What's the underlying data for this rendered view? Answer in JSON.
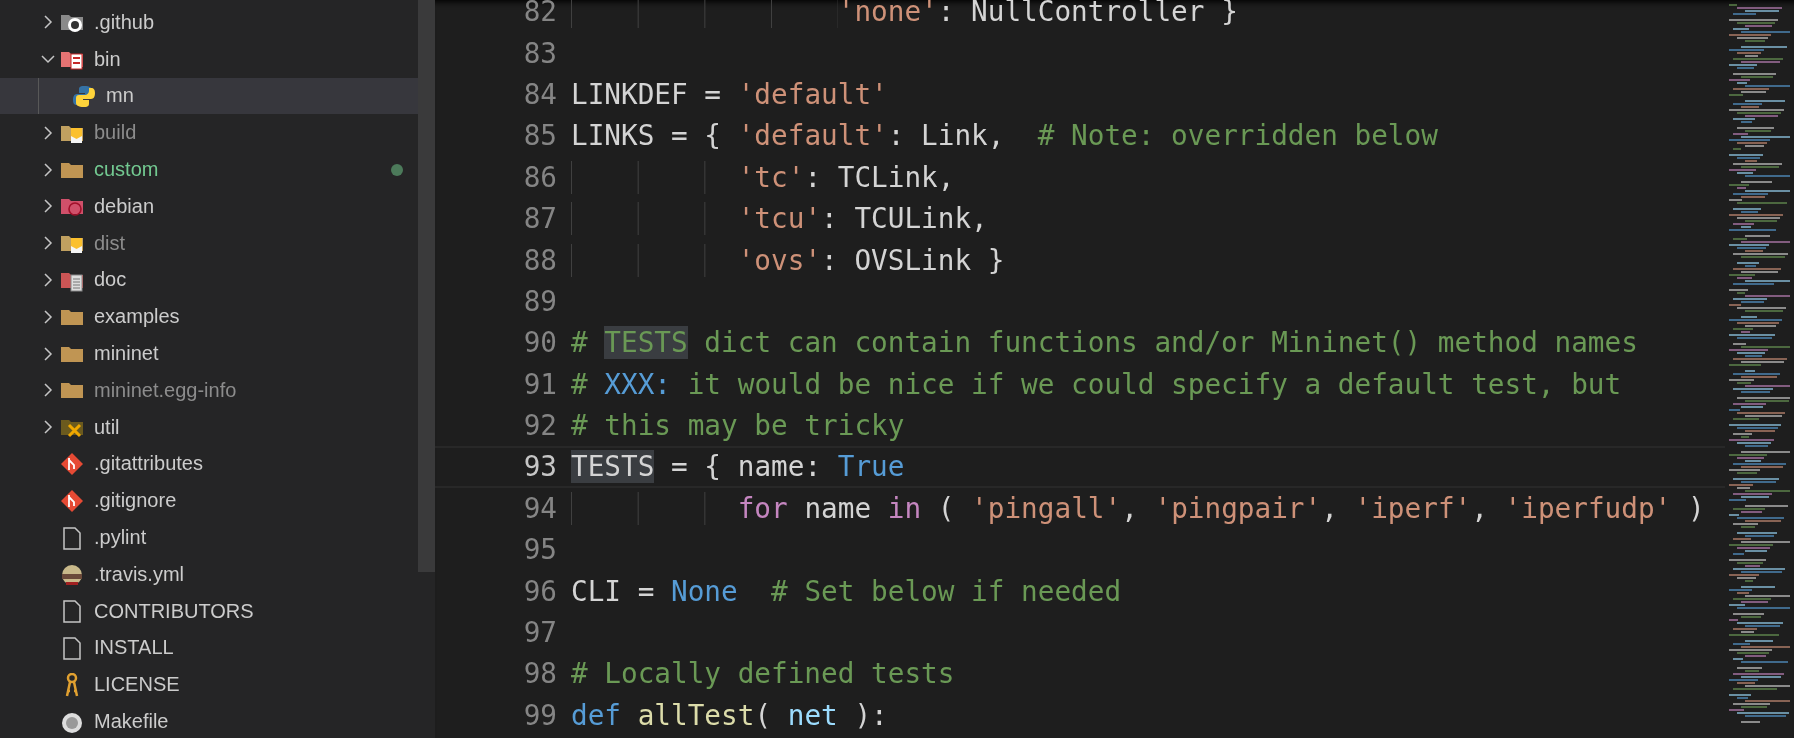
{
  "explorer": {
    "items": [
      {
        "name": ".github",
        "kind": "github-folder",
        "expanded": false,
        "ignored": false,
        "modified": false,
        "selected": false
      },
      {
        "name": "bin",
        "kind": "binary-folder",
        "expanded": true,
        "ignored": false,
        "modified": false,
        "selected": false,
        "children": [
          {
            "name": "mn",
            "kind": "python",
            "ignored": false,
            "modified": false,
            "selected": true
          }
        ]
      },
      {
        "name": "build",
        "kind": "package-folder",
        "expanded": false,
        "ignored": true,
        "modified": false,
        "selected": false
      },
      {
        "name": "custom",
        "kind": "folder",
        "expanded": false,
        "ignored": false,
        "modified": true,
        "selected": false
      },
      {
        "name": "debian",
        "kind": "swirl-folder",
        "expanded": false,
        "ignored": false,
        "modified": false,
        "selected": false
      },
      {
        "name": "dist",
        "kind": "package-folder",
        "expanded": false,
        "ignored": true,
        "modified": false,
        "selected": false
      },
      {
        "name": "doc",
        "kind": "doc-folder",
        "expanded": false,
        "ignored": false,
        "modified": false,
        "selected": false
      },
      {
        "name": "examples",
        "kind": "folder",
        "expanded": false,
        "ignored": false,
        "modified": false,
        "selected": false
      },
      {
        "name": "mininet",
        "kind": "folder",
        "expanded": false,
        "ignored": false,
        "modified": false,
        "selected": false
      },
      {
        "name": "mininet.egg-info",
        "kind": "folder",
        "expanded": false,
        "ignored": true,
        "modified": false,
        "selected": false
      },
      {
        "name": "util",
        "kind": "tools-folder",
        "expanded": false,
        "ignored": false,
        "modified": false,
        "selected": false
      },
      {
        "name": ".gitattributes",
        "kind": "git",
        "ignored": false,
        "modified": false,
        "selected": false
      },
      {
        "name": ".gitignore",
        "kind": "git",
        "ignored": false,
        "modified": false,
        "selected": false
      },
      {
        "name": ".pylint",
        "kind": "file",
        "ignored": false,
        "modified": false,
        "selected": false
      },
      {
        "name": ".travis.yml",
        "kind": "helmet",
        "ignored": false,
        "modified": false,
        "selected": false
      },
      {
        "name": "CONTRIBUTORS",
        "kind": "file",
        "ignored": false,
        "modified": false,
        "selected": false
      },
      {
        "name": "INSTALL",
        "kind": "file",
        "ignored": false,
        "modified": false,
        "selected": false
      },
      {
        "name": "LICENSE",
        "kind": "key",
        "ignored": false,
        "modified": false,
        "selected": false
      },
      {
        "name": "Makefile",
        "kind": "round",
        "ignored": false,
        "modified": false,
        "selected": false
      }
    ]
  },
  "editor": {
    "lines": [
      {
        "number": "82",
        "current": false,
        "tokens": [
          {
            "kind": "string",
            "text": "                'none'"
          },
          {
            "kind": "plain",
            "text": ": NullController }"
          }
        ]
      },
      {
        "number": "83",
        "current": false
      },
      {
        "number": "84",
        "current": false,
        "tokens": [
          {
            "kind": "plain",
            "text": "LINKDEF = "
          },
          {
            "kind": "string",
            "text": "'default'"
          }
        ]
      },
      {
        "number": "85",
        "current": false,
        "tokens": [
          {
            "kind": "plain",
            "text": "LINKS = { "
          },
          {
            "kind": "string",
            "text": "'default'"
          },
          {
            "kind": "plain",
            "text": ": Link,  "
          },
          {
            "kind": "comment",
            "text": "# Note: overridden below"
          }
        ]
      },
      {
        "number": "86",
        "current": false,
        "tokens": [
          {
            "kind": "string",
            "text": "          'tc'"
          },
          {
            "kind": "plain",
            "text": ": TCLink,"
          }
        ]
      },
      {
        "number": "87",
        "current": false,
        "tokens": [
          {
            "kind": "string",
            "text": "          'tcu'"
          },
          {
            "kind": "plain",
            "text": ": TCULink,"
          }
        ]
      },
      {
        "number": "88",
        "current": false,
        "tokens": [
          {
            "kind": "string",
            "text": "          'ovs'"
          },
          {
            "kind": "plain",
            "text": ": OVSLink }"
          }
        ]
      },
      {
        "number": "89",
        "current": false
      },
      {
        "number": "90",
        "current": false,
        "tokens": [
          {
            "kind": "comment",
            "text": "# "
          },
          {
            "kind": "comment-match",
            "text": "TESTS"
          },
          {
            "kind": "comment",
            "text": " dict can contain functions and/or Mininet() method names"
          }
        ]
      },
      {
        "number": "91",
        "current": false,
        "tokens": [
          {
            "kind": "comment",
            "text": "# "
          },
          {
            "kind": "tag",
            "text": "XXX:"
          },
          {
            "kind": "comment",
            "text": " it would be nice if we could specify a default test, but"
          }
        ]
      },
      {
        "number": "92",
        "current": false,
        "tokens": [
          {
            "kind": "comment",
            "text": "# this may be tricky"
          }
        ]
      },
      {
        "number": "93",
        "current": true,
        "tokens": [
          {
            "kind": "match",
            "text": "TESTS"
          },
          {
            "kind": "plain",
            "text": " = { name: "
          },
          {
            "kind": "keyword",
            "text": "True"
          }
        ]
      },
      {
        "number": "94",
        "current": false,
        "tokens": [
          {
            "kind": "control",
            "text": "          for"
          },
          {
            "kind": "plain",
            "text": " name "
          },
          {
            "kind": "control",
            "text": "in"
          },
          {
            "kind": "plain",
            "text": " ( "
          },
          {
            "kind": "string",
            "text": "'pingall'"
          },
          {
            "kind": "plain",
            "text": ", "
          },
          {
            "kind": "string",
            "text": "'pingpair'"
          },
          {
            "kind": "plain",
            "text": ", "
          },
          {
            "kind": "string",
            "text": "'iperf'"
          },
          {
            "kind": "plain",
            "text": ", "
          },
          {
            "kind": "string",
            "text": "'iperfudp'"
          },
          {
            "kind": "plain",
            "text": " )"
          }
        ]
      },
      {
        "number": "95",
        "current": false
      },
      {
        "number": "96",
        "current": false,
        "tokens": [
          {
            "kind": "plain",
            "text": "CLI = "
          },
          {
            "kind": "keyword",
            "text": "None"
          },
          {
            "kind": "comment",
            "text": "  # Set below if needed"
          }
        ]
      },
      {
        "number": "97",
        "current": false
      },
      {
        "number": "98",
        "current": false,
        "tokens": [
          {
            "kind": "comment",
            "text": "# Locally defined tests"
          }
        ]
      },
      {
        "number": "99",
        "current": false,
        "tokens": [
          {
            "kind": "keyword",
            "text": "def "
          },
          {
            "kind": "function",
            "text": "allTest"
          },
          {
            "kind": "plain",
            "text": "( "
          },
          {
            "kind": "param",
            "text": "net"
          },
          {
            "kind": "plain",
            "text": " ):"
          }
        ]
      }
    ]
  }
}
